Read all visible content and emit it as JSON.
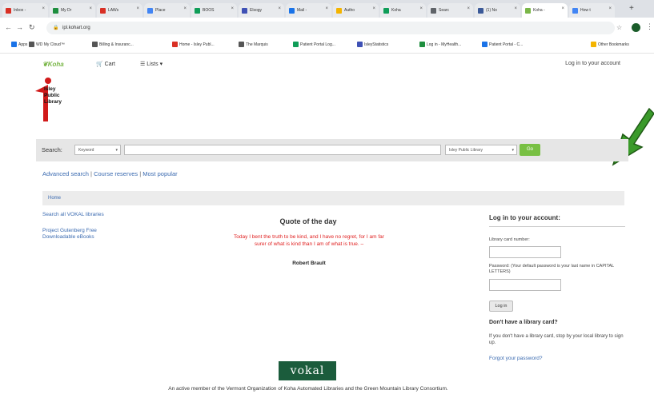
{
  "browser": {
    "tabs": [
      {
        "label": "Inbox -",
        "color": "#d93025"
      },
      {
        "label": "My Dr",
        "color": "#1e8e3e"
      },
      {
        "label": "LAWs",
        "color": "#d93025"
      },
      {
        "label": "Place",
        "color": "#4285f4"
      },
      {
        "label": "BOOS",
        "color": "#0f9d58"
      },
      {
        "label": "Elsogy",
        "color": "#3f51b5"
      },
      {
        "label": "Mail -",
        "color": "#1a73e8"
      },
      {
        "label": "Autho",
        "color": "#f4b400"
      },
      {
        "label": "Koha",
        "color": "#0f9d58"
      },
      {
        "label": "Searc",
        "color": "#5f6368"
      },
      {
        "label": "(1) No",
        "color": "#3b5998"
      },
      {
        "label": "Koha -",
        "color": "#7ab648"
      },
      {
        "label": "How t",
        "color": "#4285f4"
      }
    ],
    "url": "ipl.kohart.org",
    "bookmarks": [
      {
        "label": "Apps",
        "color": "#1a73e8"
      },
      {
        "label": "WD My Cloud™",
        "color": "#555555"
      },
      {
        "label": "Billing & Insuranc...",
        "color": "#555555"
      },
      {
        "label": "Home - Isley Publ...",
        "color": "#d93025"
      },
      {
        "label": "The Marquis",
        "color": "#555555"
      },
      {
        "label": "Patient Portal Log...",
        "color": "#0f9d58"
      },
      {
        "label": "IsleyStatistics",
        "color": "#3f51b5"
      },
      {
        "label": "Log in - MyHealth...",
        "color": "#1e8e3e"
      },
      {
        "label": "Patient Portal - C...",
        "color": "#1a73e8"
      },
      {
        "label": "Other Bookmarks",
        "color": "#f4b400"
      }
    ]
  },
  "koha_nav": {
    "logo": "Koha",
    "cart": "Cart",
    "lists": "Lists",
    "login_link": "Log in to your account"
  },
  "library_logo": {
    "line1": "Isley",
    "line2": "Public",
    "line3": "Library"
  },
  "search": {
    "label": "Search:",
    "type_value": "Keyword",
    "library_value": "Isley Public Library",
    "go_label": "Go"
  },
  "links": {
    "advanced": "Advanced search",
    "course": "Course reserves",
    "popular": "Most popular",
    "sep": "|"
  },
  "breadcrumb": {
    "home": "Home"
  },
  "left_links": {
    "vokal": "Search all VOKAL libraries",
    "gutenberg": "Project Gutenberg Free Downloadable eBooks"
  },
  "quote": {
    "title": "Quote of the day",
    "text": "Today I bent the truth to be kind, and I have no regret, for I am far surer of what is kind than I am of what is true. –",
    "author": "Robert Brault"
  },
  "login_panel": {
    "title": "Log in to your account:",
    "card_label": "Library card number:",
    "password_label": "Password: (Your default password is your last name in CAPITAL LETTERS)",
    "login_button": "Log in",
    "no_card_title": "Don't have a library card?",
    "no_card_text": "If you don't have a library card, stop by your local library to sign up.",
    "forgot": "Forgot your password?"
  },
  "footer": {
    "vokal_logo": "vokal",
    "text": "An active member of the Vermont Organization of Koha Automated Libraries and the Green Mountain Library Consortium."
  },
  "colors": {
    "arrow": "#3a9a2a",
    "link": "#3a6ab0",
    "quote": "#e02020",
    "go": "#78c043"
  }
}
